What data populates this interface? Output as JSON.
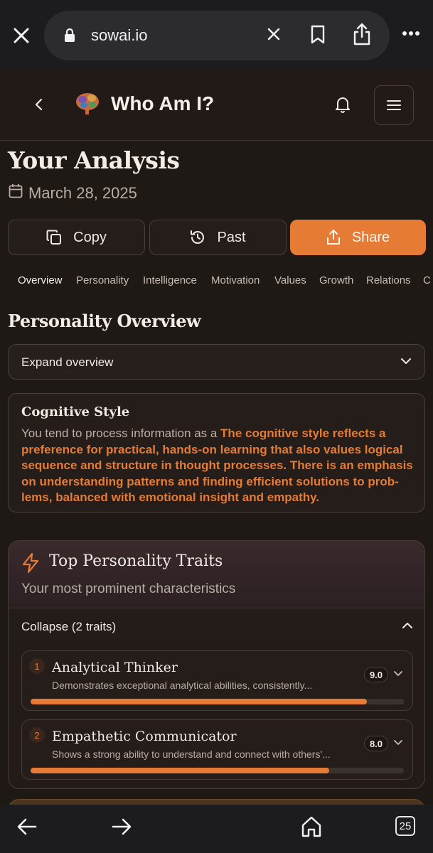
{
  "browser": {
    "url": "sowai.io",
    "open_tabs_count": "25"
  },
  "header": {
    "title": "Who Am I?"
  },
  "analysis": {
    "title": "Your Analysis",
    "date": "March 28, 2025"
  },
  "actions": {
    "copy_label": "Copy",
    "past_label": "Past",
    "share_label": "Share"
  },
  "tabs": [
    "Overview",
    "Personality",
    "Intelligence",
    "Motivation",
    "Values",
    "Growth",
    "Relations",
    "C"
  ],
  "overview": {
    "section_title": "Personality Overview",
    "expand_label": "Expand overview"
  },
  "cognitive": {
    "title": "Cognitive Style",
    "intro": "You tend to process information as a ",
    "highlight": "The cognitive style reflects a preference for practical, hands-on learning that also values logical sequence and structure in thought processes. There is an emphasis on understanding patterns and finding efficient solutions to prob-lems, balanced with emotional insight and empathy."
  },
  "traits": {
    "title": "Top Personality Traits",
    "subtitle": "Your most prominent characteristics",
    "collapse_label": "Collapse (2 traits)",
    "items": [
      {
        "rank": "1",
        "name": "Analytical Thinker",
        "description": "Demonstrates exceptional analytical abilities, consistently...",
        "score": "9.0",
        "fill": 0.9
      },
      {
        "rank": "2",
        "name": "Empathetic Communicator",
        "description": "Shows a strong ability to understand and connect with others'...",
        "score": "8.0",
        "fill": 0.8
      }
    ]
  },
  "colors": {
    "accent": "#e57b35",
    "background": "#1f1916"
  }
}
